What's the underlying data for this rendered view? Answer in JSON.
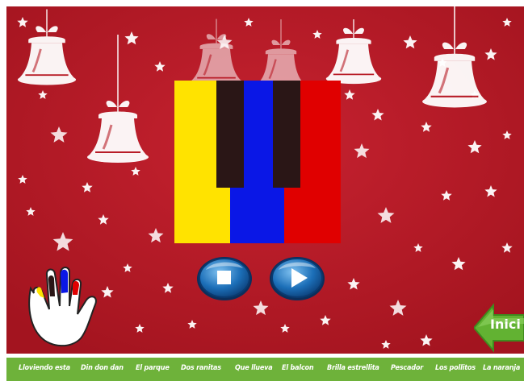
{
  "colors": {
    "background": "#b81c27",
    "key_yellow": "#ffe300",
    "key_blue": "#0a17e6",
    "key_red": "#e00000",
    "black_key": "#2a1616",
    "menu_bar": "#6eb23a",
    "home_arrow": "#62b232"
  },
  "piano": {
    "white_keys": [
      "yellow",
      "blue",
      "red"
    ],
    "black_key_count": 2
  },
  "controls": {
    "stop_icon": "stop-icon",
    "play_icon": "play-icon"
  },
  "home": {
    "label": "Inici"
  },
  "menu": {
    "songs": [
      "Lloviendo esta",
      "Din don dan",
      "El parque",
      "Dos ranitas",
      "Que llueva",
      "El balcon",
      "Brilla estrellita",
      "Pescador",
      "Los pollitos",
      "La naranja"
    ]
  }
}
